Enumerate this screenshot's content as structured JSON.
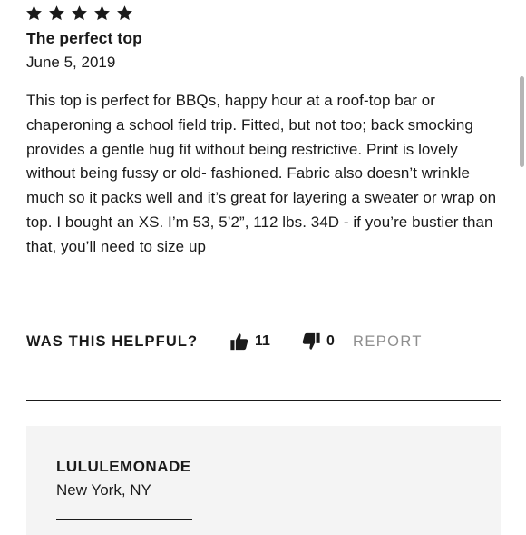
{
  "review": {
    "rating": 5,
    "rating_max": 5,
    "title": "The perfect top",
    "date": "June 5, 2019",
    "body": "This top is perfect for BBQs, happy hour at a roof-top bar or chaperoning a school field trip. Fitted, but not too; back smocking provides a gentle hug fit without being restrictive. Print is lovely without being fussy or old- fashioned. Fabric also doesn’t wrinkle much so it packs well and it’s great for layering a sweater or wrap on top. I bought an XS. I’m 53, 5’2”, 112 lbs. 34D - if you’re bustier than that, you’ll need to size up"
  },
  "helpful": {
    "label": "WAS THIS HELPFUL?",
    "up_icon": "thumbs-up-icon",
    "up_count": "11",
    "down_icon": "thumbs-down-icon",
    "down_count": "0",
    "report_label": "REPORT"
  },
  "reviewer": {
    "name": "LULULEMONADE",
    "location": "New York, NY"
  },
  "colors": {
    "text": "#1a1a1a",
    "muted": "#8e8e8e",
    "card_bg": "#f4f4f4",
    "star": "#1a1a1a"
  }
}
